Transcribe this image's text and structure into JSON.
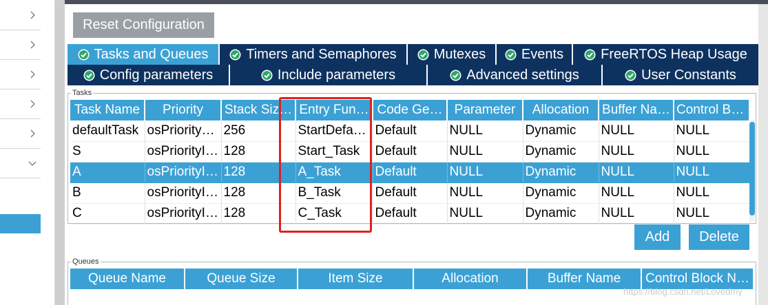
{
  "toolbar": {
    "reset_label": "Reset Configuration"
  },
  "tabs_row1": [
    {
      "label": "Tasks and Queues",
      "active": true
    },
    {
      "label": "Timers and Semaphores",
      "active": false
    },
    {
      "label": "Mutexes",
      "active": false
    },
    {
      "label": "Events",
      "active": false
    },
    {
      "label": "FreeRTOS Heap Usage",
      "active": false
    }
  ],
  "tabs_row2": [
    {
      "label": "Config parameters"
    },
    {
      "label": "Include parameters"
    },
    {
      "label": "Advanced settings"
    },
    {
      "label": "User Constants"
    }
  ],
  "tasks": {
    "group_label": "Tasks",
    "columns": [
      "Task Name",
      "Priority",
      "Stack Siz…",
      "Entry Fun…",
      "Code Ge…",
      "Parameter",
      "Allocation",
      "Buffer Na…",
      "Control Bl…"
    ],
    "rows": [
      [
        "defaultTask",
        "osPriority…",
        "256",
        "StartDefa…",
        "Default",
        "NULL",
        "Dynamic",
        "NULL",
        "NULL"
      ],
      [
        "S",
        "osPriorityI…",
        "128",
        "Start_Task",
        "Default",
        "NULL",
        "Dynamic",
        "NULL",
        "NULL"
      ],
      [
        "A",
        "osPriorityI…",
        "128",
        "A_Task",
        "Default",
        "NULL",
        "Dynamic",
        "NULL",
        "NULL"
      ],
      [
        "B",
        "osPriorityI…",
        "128",
        "B_Task",
        "Default",
        "NULL",
        "Dynamic",
        "NULL",
        "NULL"
      ],
      [
        "C",
        "osPriorityI…",
        "128",
        "C_Task",
        "Default",
        "NULL",
        "Dynamic",
        "NULL",
        "NULL"
      ]
    ],
    "selected_row": "A",
    "add_label": "Add",
    "delete_label": "Delete"
  },
  "queues": {
    "group_label": "Queues",
    "columns": [
      "Queue Name",
      "Queue Size",
      "Item Size",
      "Allocation",
      "Buffer Name",
      "Control Block N…"
    ]
  },
  "sidebar": {
    "items": [
      {
        "icon": "chevron-right-icon"
      },
      {
        "icon": "chevron-right-icon"
      },
      {
        "icon": "chevron-right-icon"
      },
      {
        "icon": "chevron-right-icon"
      },
      {
        "icon": "chevron-right-icon"
      },
      {
        "icon": "chevron-down-icon"
      }
    ]
  },
  "watermark": "https://blog.csdn.net/Lovedmy",
  "colors": {
    "accent": "#3ba1d5",
    "navy": "#0e3260",
    "reset_button": "#9a9fa6",
    "highlight": "#e02020",
    "check": "#2ea56a"
  }
}
